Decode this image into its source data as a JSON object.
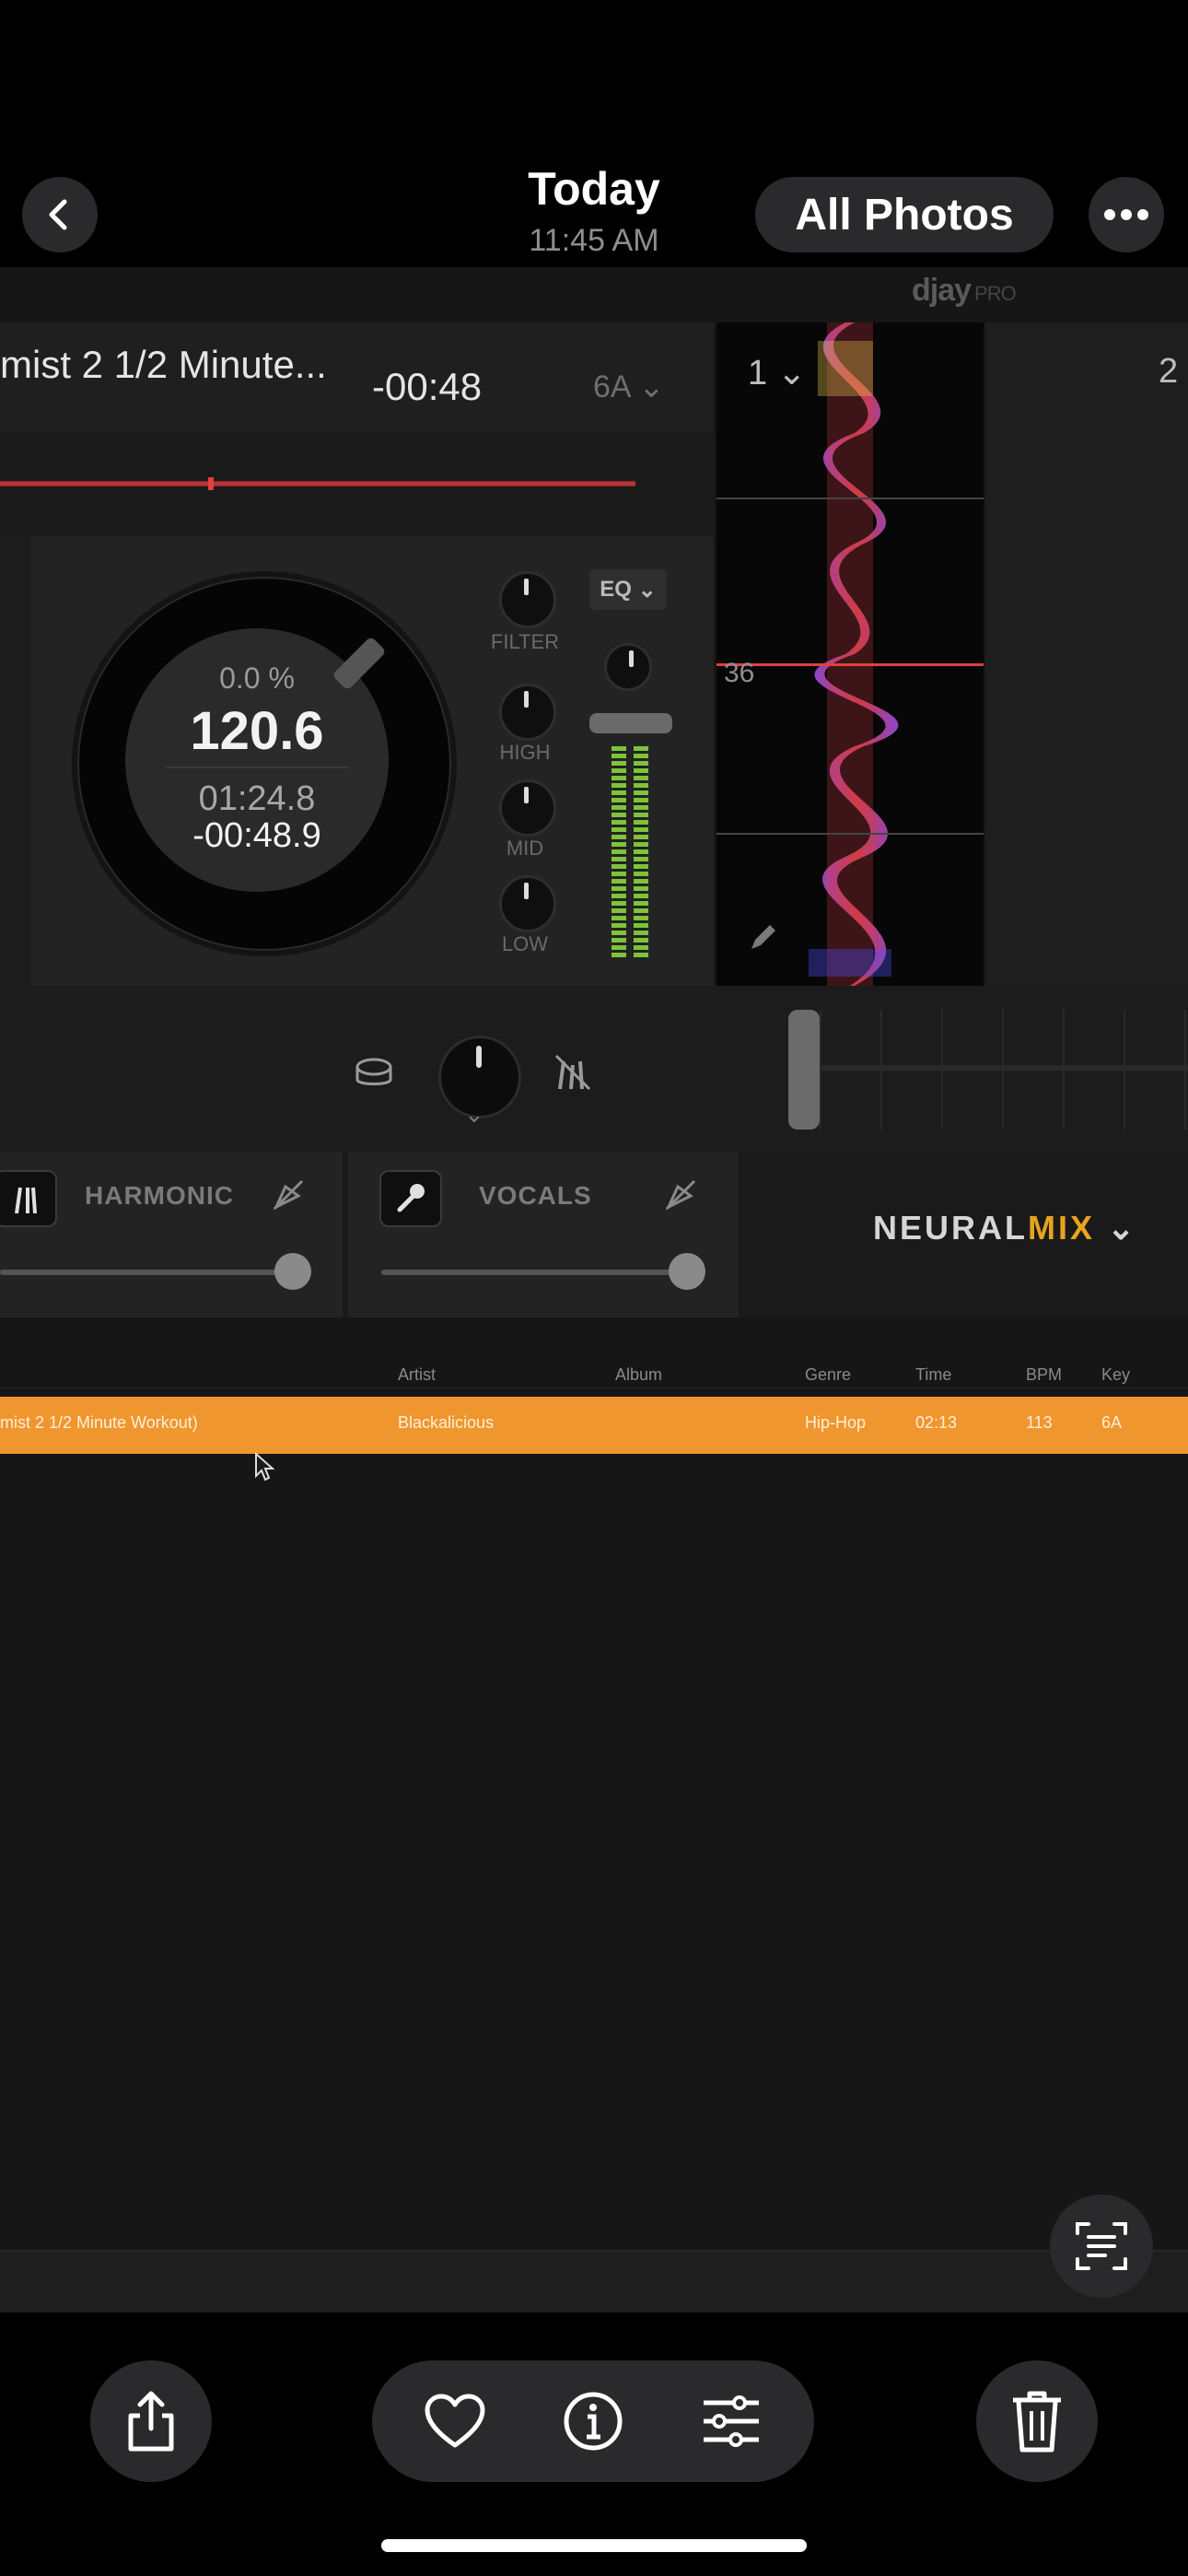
{
  "header": {
    "title": "Today",
    "subtitle": "11:45 AM",
    "all_photos_label": "All Photos"
  },
  "djay": {
    "brand": "djay",
    "brand_suffix": "PRO",
    "deck1": {
      "track_title": "mist 2 1/2 Minute...",
      "remaining": "-00:48",
      "key": "6A",
      "pitch": "0.0 %",
      "bpm": "120.6",
      "elapsed": "01:24.8",
      "remaining_precise": "-00:48.9",
      "knobs": [
        "FILTER",
        "HIGH",
        "MID",
        "LOW"
      ],
      "eq_label": "EQ",
      "waveform_deck_number": "1",
      "waveform_marker": "36"
    },
    "deck2": {
      "number": "2"
    },
    "neural_mix": {
      "stems": [
        {
          "label": "HARMONIC",
          "level": 1.0
        },
        {
          "label": "VOCALS",
          "level": 1.0
        }
      ],
      "brand_neural": "NEURAL",
      "brand_mix": "MIX"
    },
    "library": {
      "columns": [
        "Artist",
        "Album",
        "Genre",
        "Time",
        "BPM",
        "Key"
      ],
      "selected_row": {
        "title": "mist 2 1/2 Minute Workout)",
        "artist": "Blackalicious",
        "album": "",
        "genre": "Hip-Hop",
        "time": "02:13",
        "bpm": "113",
        "key": "6A"
      }
    }
  },
  "colors": {
    "accent_orange": "#f0962e",
    "mix_gold": "#e6a41f",
    "meter_green": "#7ec33a"
  },
  "icons": {
    "back": "chevron-left-icon",
    "more": "ellipsis-icon",
    "share": "share-icon",
    "favorite": "heart-icon",
    "info": "info-icon",
    "edit": "sliders-icon",
    "delete": "trash-icon",
    "live_text": "live-text-icon"
  }
}
